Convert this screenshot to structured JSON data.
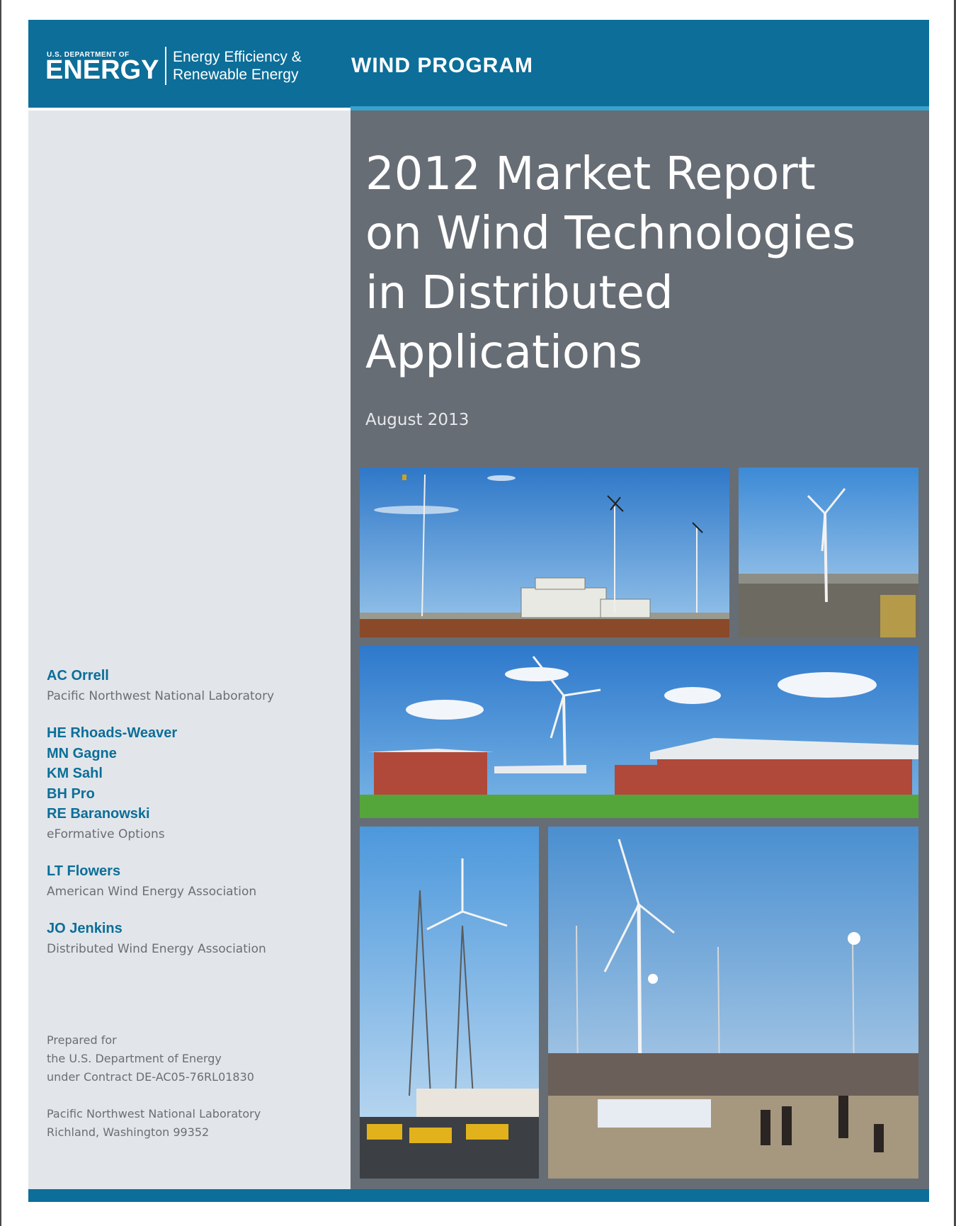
{
  "header": {
    "doe_small": "U.S. DEPARTMENT OF",
    "doe_large": "ENERGY",
    "office_line1": "Energy Efficiency &",
    "office_line2": "Renewable Energy",
    "program": "WIND PROGRAM"
  },
  "title_lines": [
    "2012 Market Report",
    "on Wind Technologies",
    "in Distributed",
    "Applications"
  ],
  "date": "August 2013",
  "author_groups": [
    {
      "names": [
        "AC Orrell"
      ],
      "org": "Pacific Northwest National Laboratory"
    },
    {
      "names": [
        "HE Rhoads-Weaver",
        "MN Gagne",
        "KM Sahl",
        "BH Pro",
        "RE Baranowski"
      ],
      "org": "eFormative Options"
    },
    {
      "names": [
        "LT Flowers"
      ],
      "org": "American Wind Energy Association"
    },
    {
      "names": [
        "JO Jenkins"
      ],
      "org": "Distributed Wind Energy Association"
    }
  ],
  "prepared": {
    "lines": [
      "Prepared for",
      "the U.S. Department of Energy",
      "under Contract DE-AC05-76RL01830"
    ],
    "lab_lines": [
      "Pacific Northwest National Laboratory",
      "Richland, Washington 99352"
    ]
  },
  "colors": {
    "brand_blue": "#0c6e99",
    "title_panel": "#676d75",
    "left_panel": "#e2e6ea"
  }
}
